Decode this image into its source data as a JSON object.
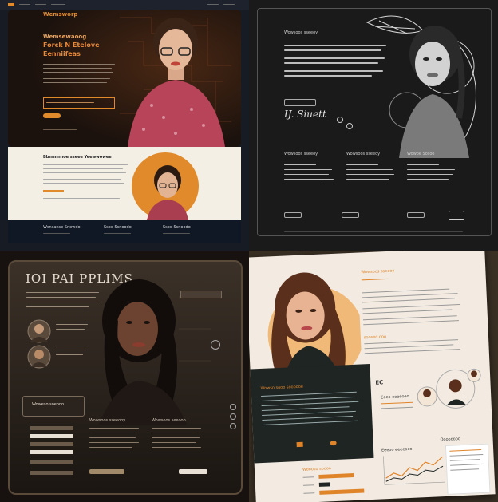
{
  "q1": {
    "brand": "Wemsworp",
    "hero_line1": "Wemsewaoog",
    "hero_line2": "Forck N Etelove",
    "hero_line3": "Eenniifeas",
    "cta_label": "Ueee slsee",
    "section_title": "Bbnnnnnoe sseee Yeewwowee",
    "footer_col1": "Wsnsanse Snowdo",
    "footer_col2": "Ssoo Ssnoodo",
    "footer_col3": "Ssoo Ssnoodo",
    "accent": "#e08a2c"
  },
  "q2": {
    "name_sig": "IJ. Siuett",
    "header_text": "Wowsoos sseeoy",
    "col1_title": "Wowsoos sseeoy",
    "col2_title": "Wowsoos sseeoy",
    "col3_title": "Wowoe Sosoo"
  },
  "q3": {
    "headline": "IOI PAI PPLIMS",
    "banner": "Woweso soeooo",
    "col1_title": "Wowsoos sseeooy",
    "col2_title": "Wowsoos seeooo"
  },
  "q4": {
    "header_text": "Wowsoos sseeoy",
    "small_tag": "sooseo ooo",
    "eco_label": "EC",
    "eee_label": "Eeeo eeeeoeo",
    "dark_title": "Wowso sooo soooooe",
    "chart_title": "Oooooooo",
    "chart_sub": "Eeeoo eeeeoeo",
    "bars_title": "Woooso soooo",
    "accent": "#e0842a"
  }
}
